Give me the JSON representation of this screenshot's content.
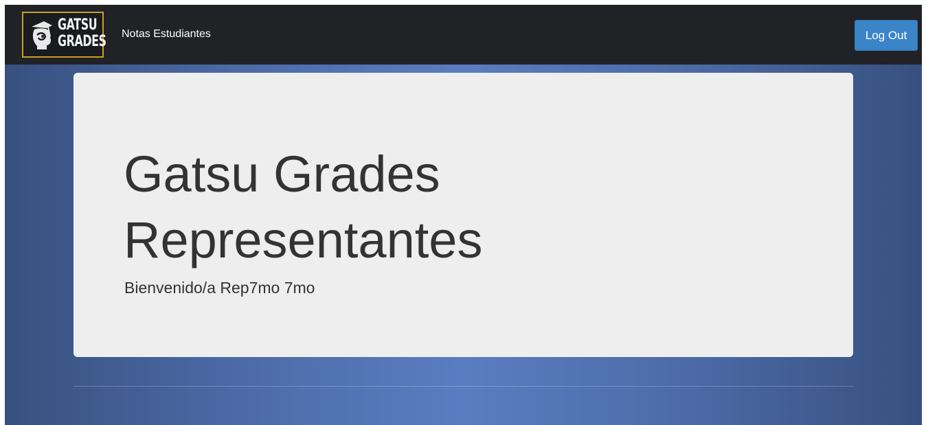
{
  "navbar": {
    "brand": {
      "line1": "GATSU",
      "line2": "GRADES",
      "border_color": "#c9a227"
    },
    "link_label": "Notas Estudiantes",
    "logout_label": "Log Out",
    "logout_color": "#3a85c8"
  },
  "hero": {
    "title_line1": "Gatsu Grades",
    "title_line2": "Representantes",
    "welcome_text": "Bienvenido/a Rep7mo 7mo"
  },
  "colors": {
    "navbar_bg": "#202226",
    "page_bg_center": "#5a7dc1",
    "page_bg_edge": "#37507e",
    "card_bg": "#eeeeee"
  }
}
